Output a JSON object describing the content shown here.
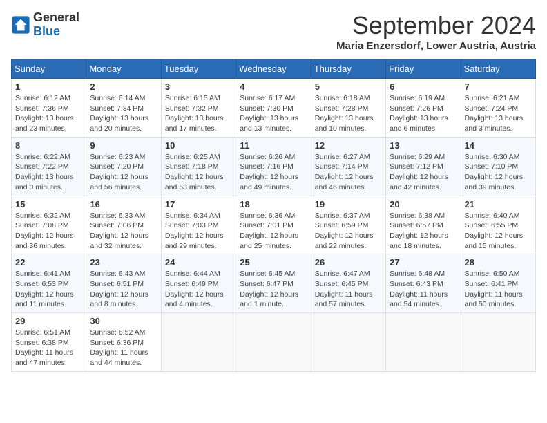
{
  "logo": {
    "general": "General",
    "blue": "Blue"
  },
  "header": {
    "month": "September 2024",
    "location": "Maria Enzersdorf, Lower Austria, Austria"
  },
  "weekdays": [
    "Sunday",
    "Monday",
    "Tuesday",
    "Wednesday",
    "Thursday",
    "Friday",
    "Saturday"
  ],
  "weeks": [
    [
      {
        "day": "1",
        "info": "Sunrise: 6:12 AM\nSunset: 7:36 PM\nDaylight: 13 hours\nand 23 minutes."
      },
      {
        "day": "2",
        "info": "Sunrise: 6:14 AM\nSunset: 7:34 PM\nDaylight: 13 hours\nand 20 minutes."
      },
      {
        "day": "3",
        "info": "Sunrise: 6:15 AM\nSunset: 7:32 PM\nDaylight: 13 hours\nand 17 minutes."
      },
      {
        "day": "4",
        "info": "Sunrise: 6:17 AM\nSunset: 7:30 PM\nDaylight: 13 hours\nand 13 minutes."
      },
      {
        "day": "5",
        "info": "Sunrise: 6:18 AM\nSunset: 7:28 PM\nDaylight: 13 hours\nand 10 minutes."
      },
      {
        "day": "6",
        "info": "Sunrise: 6:19 AM\nSunset: 7:26 PM\nDaylight: 13 hours\nand 6 minutes."
      },
      {
        "day": "7",
        "info": "Sunrise: 6:21 AM\nSunset: 7:24 PM\nDaylight: 13 hours\nand 3 minutes."
      }
    ],
    [
      {
        "day": "8",
        "info": "Sunrise: 6:22 AM\nSunset: 7:22 PM\nDaylight: 13 hours\nand 0 minutes."
      },
      {
        "day": "9",
        "info": "Sunrise: 6:23 AM\nSunset: 7:20 PM\nDaylight: 12 hours\nand 56 minutes."
      },
      {
        "day": "10",
        "info": "Sunrise: 6:25 AM\nSunset: 7:18 PM\nDaylight: 12 hours\nand 53 minutes."
      },
      {
        "day": "11",
        "info": "Sunrise: 6:26 AM\nSunset: 7:16 PM\nDaylight: 12 hours\nand 49 minutes."
      },
      {
        "day": "12",
        "info": "Sunrise: 6:27 AM\nSunset: 7:14 PM\nDaylight: 12 hours\nand 46 minutes."
      },
      {
        "day": "13",
        "info": "Sunrise: 6:29 AM\nSunset: 7:12 PM\nDaylight: 12 hours\nand 42 minutes."
      },
      {
        "day": "14",
        "info": "Sunrise: 6:30 AM\nSunset: 7:10 PM\nDaylight: 12 hours\nand 39 minutes."
      }
    ],
    [
      {
        "day": "15",
        "info": "Sunrise: 6:32 AM\nSunset: 7:08 PM\nDaylight: 12 hours\nand 36 minutes."
      },
      {
        "day": "16",
        "info": "Sunrise: 6:33 AM\nSunset: 7:06 PM\nDaylight: 12 hours\nand 32 minutes."
      },
      {
        "day": "17",
        "info": "Sunrise: 6:34 AM\nSunset: 7:03 PM\nDaylight: 12 hours\nand 29 minutes."
      },
      {
        "day": "18",
        "info": "Sunrise: 6:36 AM\nSunset: 7:01 PM\nDaylight: 12 hours\nand 25 minutes."
      },
      {
        "day": "19",
        "info": "Sunrise: 6:37 AM\nSunset: 6:59 PM\nDaylight: 12 hours\nand 22 minutes."
      },
      {
        "day": "20",
        "info": "Sunrise: 6:38 AM\nSunset: 6:57 PM\nDaylight: 12 hours\nand 18 minutes."
      },
      {
        "day": "21",
        "info": "Sunrise: 6:40 AM\nSunset: 6:55 PM\nDaylight: 12 hours\nand 15 minutes."
      }
    ],
    [
      {
        "day": "22",
        "info": "Sunrise: 6:41 AM\nSunset: 6:53 PM\nDaylight: 12 hours\nand 11 minutes."
      },
      {
        "day": "23",
        "info": "Sunrise: 6:43 AM\nSunset: 6:51 PM\nDaylight: 12 hours\nand 8 minutes."
      },
      {
        "day": "24",
        "info": "Sunrise: 6:44 AM\nSunset: 6:49 PM\nDaylight: 12 hours\nand 4 minutes."
      },
      {
        "day": "25",
        "info": "Sunrise: 6:45 AM\nSunset: 6:47 PM\nDaylight: 12 hours\nand 1 minute."
      },
      {
        "day": "26",
        "info": "Sunrise: 6:47 AM\nSunset: 6:45 PM\nDaylight: 11 hours\nand 57 minutes."
      },
      {
        "day": "27",
        "info": "Sunrise: 6:48 AM\nSunset: 6:43 PM\nDaylight: 11 hours\nand 54 minutes."
      },
      {
        "day": "28",
        "info": "Sunrise: 6:50 AM\nSunset: 6:41 PM\nDaylight: 11 hours\nand 50 minutes."
      }
    ],
    [
      {
        "day": "29",
        "info": "Sunrise: 6:51 AM\nSunset: 6:38 PM\nDaylight: 11 hours\nand 47 minutes."
      },
      {
        "day": "30",
        "info": "Sunrise: 6:52 AM\nSunset: 6:36 PM\nDaylight: 11 hours\nand 44 minutes."
      },
      {
        "day": "",
        "info": ""
      },
      {
        "day": "",
        "info": ""
      },
      {
        "day": "",
        "info": ""
      },
      {
        "day": "",
        "info": ""
      },
      {
        "day": "",
        "info": ""
      }
    ]
  ]
}
